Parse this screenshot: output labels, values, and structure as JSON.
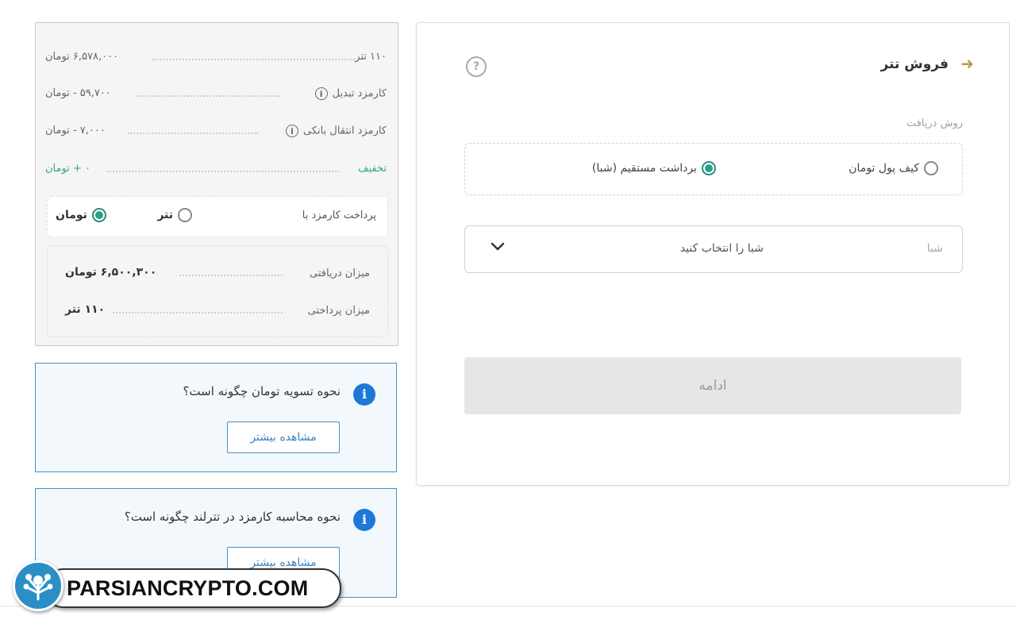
{
  "sell": {
    "title": "فروش تتر",
    "receive_method_label": "روش دریافت",
    "options": [
      {
        "label": "کیف پول تومان",
        "selected": false
      },
      {
        "label": "برداشت مستقیم (شبا)",
        "selected": true
      }
    ],
    "sheba_label": "شبا",
    "sheba_placeholder": "شبا را انتخاب کنید",
    "continue_label": "ادامه"
  },
  "summary": {
    "rows": [
      {
        "label": "۱۱۰ تتر",
        "value": "۶,۵۷۸,۰۰۰ تومان"
      },
      {
        "label": "کارمزد تبدیل",
        "value": "۵۹,۷۰۰ - تومان"
      },
      {
        "label": "کارمزد انتقال بانکی",
        "value": "۷,۰۰۰ - تومان"
      },
      {
        "label": "تخفیف",
        "value": "۰ + تومان"
      }
    ],
    "fee_pay_label": "پرداخت کارمزد با",
    "fee_options": [
      {
        "label": "تتر",
        "selected": false
      },
      {
        "label": "تومان",
        "selected": true
      }
    ],
    "received_label": "میزان دریافتی",
    "received_value": "۶,۵۰۰,۳۰۰ تومان",
    "paid_label": "میزان پرداختی",
    "paid_value": "۱۱۰ تتر"
  },
  "info_cards": [
    {
      "question": "نحوه تسویه تومان چگونه است؟",
      "button": "مشاهده بیشتر"
    },
    {
      "question": "نحوه محاسبه کارمزد در تترلند چگونه است؟",
      "button": "مشاهده بیشتر"
    }
  ],
  "watermark": {
    "text": "PARSIANCRYPTO.COM"
  },
  "colors": {
    "accent_green": "#27a08b",
    "info_blue": "#1e78d7",
    "back_arrow": "#b89a45"
  }
}
